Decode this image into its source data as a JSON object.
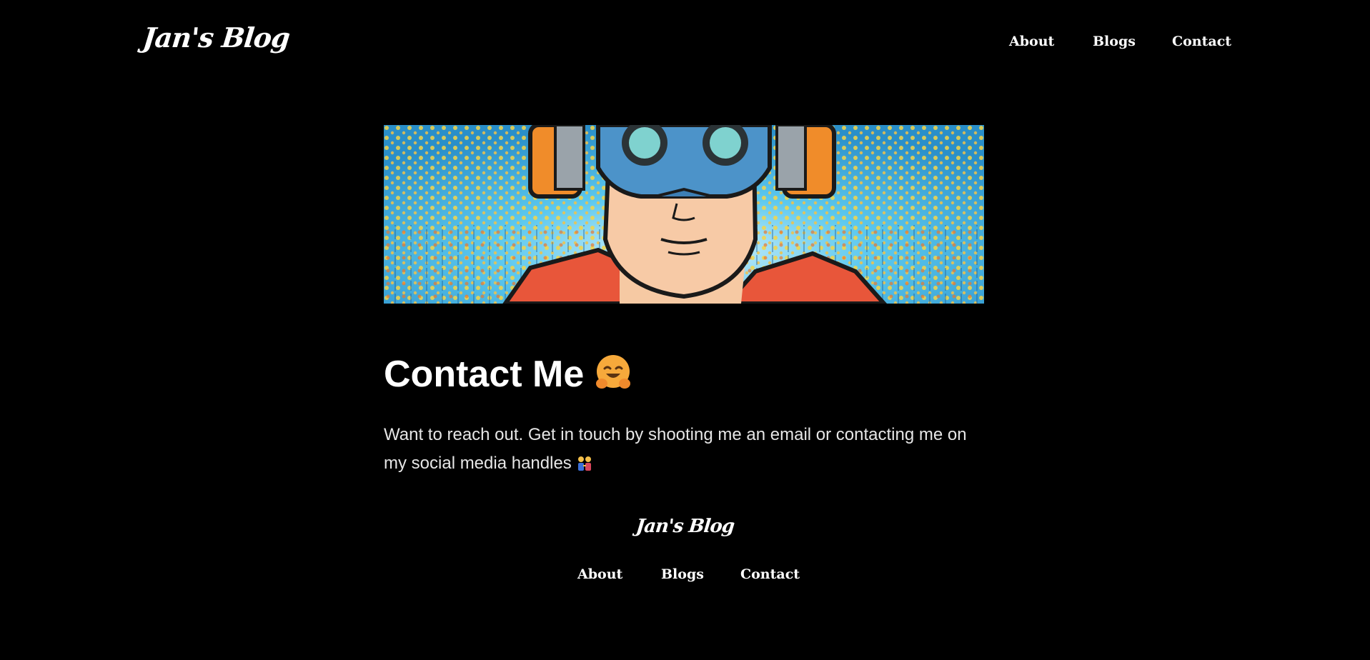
{
  "header": {
    "logo": "Jan's Blog",
    "nav": [
      {
        "label": "About"
      },
      {
        "label": "Blogs"
      },
      {
        "label": "Contact"
      }
    ]
  },
  "hero": {
    "image": "comic-style-illustration-of-man-with-goggles-and-headphones"
  },
  "main": {
    "title": "Contact Me",
    "title_emoji": "hugging-face-emoji",
    "intro": "Want to reach out. Get in touch by shooting me an email or contacting me on my social media handles",
    "intro_emoji": "people-holding-hands-emoji"
  },
  "footer": {
    "logo": "Jan's Blog",
    "nav": [
      {
        "label": "About"
      },
      {
        "label": "Blogs"
      },
      {
        "label": "Contact"
      }
    ]
  },
  "colors": {
    "background": "#000000",
    "text": "#ffffff",
    "body_text": "#e6e6e6"
  }
}
